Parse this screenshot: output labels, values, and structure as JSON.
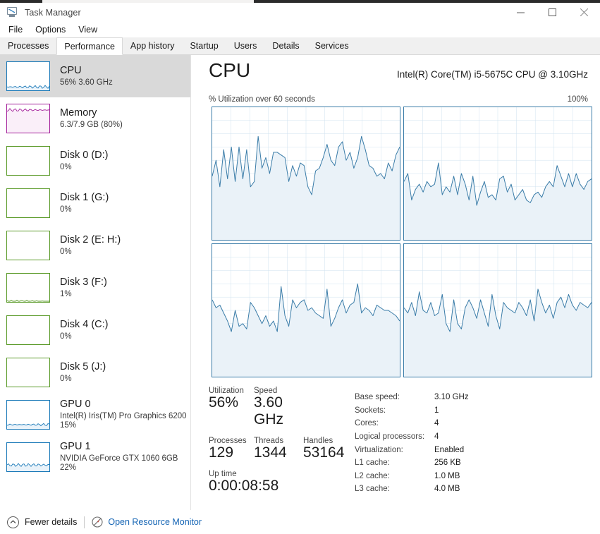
{
  "window": {
    "title": "Task Manager",
    "icon": "task-manager-icon",
    "controls": [
      {
        "name": "minimize-button",
        "glyph": "minimize"
      },
      {
        "name": "maximize-button",
        "glyph": "maximize"
      },
      {
        "name": "close-button",
        "glyph": "close"
      }
    ]
  },
  "menu": {
    "items": [
      "File",
      "Options",
      "View"
    ]
  },
  "tabs": {
    "items": [
      "Processes",
      "Performance",
      "App history",
      "Startup",
      "Users",
      "Details",
      "Services"
    ],
    "active": "Performance"
  },
  "sidebar": {
    "items": [
      {
        "title": "CPU",
        "sub": "56%  3.60 GHz",
        "sub2": "",
        "color": "#1a79b8",
        "fill": "#eaf3fa",
        "level": 0.12,
        "selected": true,
        "name": "sidebar-item-cpu"
      },
      {
        "title": "Memory",
        "sub": "6.3/7.9 GB (80%)",
        "sub2": "",
        "color": "#a4219b",
        "fill": "#faeff9",
        "level": 0.8,
        "selected": false,
        "name": "sidebar-item-memory"
      },
      {
        "title": "Disk 0 (D:)",
        "sub": "0%",
        "sub2": "",
        "color": "#5a9a28",
        "fill": "#f2f8ec",
        "level": 0.0,
        "selected": false,
        "name": "sidebar-item-disk0"
      },
      {
        "title": "Disk 1 (G:)",
        "sub": "0%",
        "sub2": "",
        "color": "#5a9a28",
        "fill": "#f2f8ec",
        "level": 0.0,
        "selected": false,
        "name": "sidebar-item-disk1"
      },
      {
        "title": "Disk 2 (E: H:)",
        "sub": "0%",
        "sub2": "",
        "color": "#5a9a28",
        "fill": "#f2f8ec",
        "level": 0.0,
        "selected": false,
        "name": "sidebar-item-disk2"
      },
      {
        "title": "Disk 3 (F:)",
        "sub": "1%",
        "sub2": "",
        "color": "#5a9a28",
        "fill": "#f2f8ec",
        "level": 0.01,
        "selected": false,
        "name": "sidebar-item-disk3"
      },
      {
        "title": "Disk 4 (C:)",
        "sub": "0%",
        "sub2": "",
        "color": "#5a9a28",
        "fill": "#f2f8ec",
        "level": 0.0,
        "selected": false,
        "name": "sidebar-item-disk4"
      },
      {
        "title": "Disk 5 (J:)",
        "sub": "0%",
        "sub2": "",
        "color": "#5a9a28",
        "fill": "#f2f8ec",
        "level": 0.0,
        "selected": false,
        "name": "sidebar-item-disk5"
      },
      {
        "title": "GPU 0",
        "sub": "Intel(R) Iris(TM) Pro Graphics 6200",
        "sub2": "15%",
        "color": "#1a79b8",
        "fill": "#eaf3fa",
        "level": 0.15,
        "selected": false,
        "name": "sidebar-item-gpu0"
      },
      {
        "title": "GPU 1",
        "sub": "NVIDIA GeForce GTX 1060 6GB",
        "sub2": "22%",
        "color": "#1a79b8",
        "fill": "#eaf3fa",
        "level": 0.22,
        "selected": false,
        "name": "sidebar-item-gpu1"
      }
    ]
  },
  "main": {
    "title": "CPU",
    "model": "Intel(R) Core(TM) i5-5675C CPU @ 3.10GHz",
    "graph_label": "% Utilization over 60 seconds",
    "graph_max": "100%"
  },
  "stats": {
    "utilization_label": "Utilization",
    "utilization_value": "56%",
    "speed_label": "Speed",
    "speed_value": "3.60 GHz",
    "processes_label": "Processes",
    "processes_value": "129",
    "threads_label": "Threads",
    "threads_value": "1344",
    "handles_label": "Handles",
    "handles_value": "53164",
    "uptime_label": "Up time",
    "uptime_value": "0:00:08:58"
  },
  "specs": [
    {
      "key": "Base speed:",
      "value": "3.10 GHz"
    },
    {
      "key": "Sockets:",
      "value": "1"
    },
    {
      "key": "Cores:",
      "value": "4"
    },
    {
      "key": "Logical processors:",
      "value": "4"
    },
    {
      "key": "Virtualization:",
      "value": "Enabled"
    },
    {
      "key": "L1 cache:",
      "value": "256 KB"
    },
    {
      "key": "L2 cache:",
      "value": "1.0 MB"
    },
    {
      "key": "L3 cache:",
      "value": "4.0 MB"
    }
  ],
  "footer": {
    "fewer_details": "Fewer details",
    "resource_monitor": "Open Resource Monitor"
  },
  "colors": {
    "graph_line": "#3a7ca8",
    "graph_fill": "#eaf2f8",
    "graph_border": "#3a7ca8",
    "grid": "#cfe2ef",
    "link": "#1464b4",
    "selection": "#d9d9d9"
  },
  "chart_data": {
    "type": "line",
    "title": "% Utilization over 60 seconds",
    "ylabel": "% Utilization",
    "xlabel": "60 seconds",
    "ylim": [
      0,
      100
    ],
    "grid": true,
    "charts": [
      {
        "name": "cpu-core-0",
        "values": [
          48,
          60,
          40,
          68,
          46,
          70,
          44,
          70,
          46,
          68,
          40,
          44,
          78,
          54,
          62,
          50,
          66,
          66,
          64,
          62,
          44,
          56,
          48,
          58,
          56,
          40,
          34,
          52,
          54,
          62,
          72,
          60,
          56,
          70,
          74,
          60,
          66,
          54,
          62,
          78,
          68,
          56,
          54,
          48,
          50,
          46,
          58,
          52,
          64,
          70
        ]
      },
      {
        "name": "cpu-core-1",
        "values": [
          44,
          50,
          30,
          38,
          42,
          36,
          44,
          40,
          42,
          58,
          34,
          40,
          36,
          48,
          34,
          50,
          42,
          30,
          48,
          26,
          36,
          44,
          32,
          34,
          30,
          46,
          48,
          36,
          42,
          30,
          34,
          38,
          30,
          28,
          34,
          36,
          32,
          40,
          44,
          40,
          56,
          48,
          40,
          50,
          40,
          50,
          42,
          38,
          44,
          46
        ]
      },
      {
        "name": "cpu-core-2",
        "values": [
          58,
          52,
          54,
          48,
          42,
          34,
          50,
          38,
          40,
          36,
          56,
          52,
          46,
          40,
          46,
          38,
          42,
          34,
          68,
          46,
          38,
          58,
          52,
          56,
          58,
          50,
          52,
          48,
          46,
          44,
          66,
          38,
          44,
          52,
          58,
          48,
          54,
          56,
          70,
          48,
          52,
          50,
          46,
          54,
          52,
          50,
          50,
          48,
          46,
          42
        ]
      },
      {
        "name": "cpu-core-3",
        "values": [
          52,
          48,
          56,
          46,
          64,
          50,
          48,
          56,
          46,
          48,
          62,
          40,
          34,
          58,
          40,
          36,
          52,
          58,
          52,
          44,
          58,
          48,
          38,
          62,
          46,
          36,
          56,
          52,
          50,
          48,
          56,
          52,
          46,
          58,
          42,
          66,
          56,
          48,
          54,
          44,
          56,
          60,
          52,
          62,
          54,
          50,
          56,
          54,
          52,
          56
        ]
      }
    ]
  }
}
